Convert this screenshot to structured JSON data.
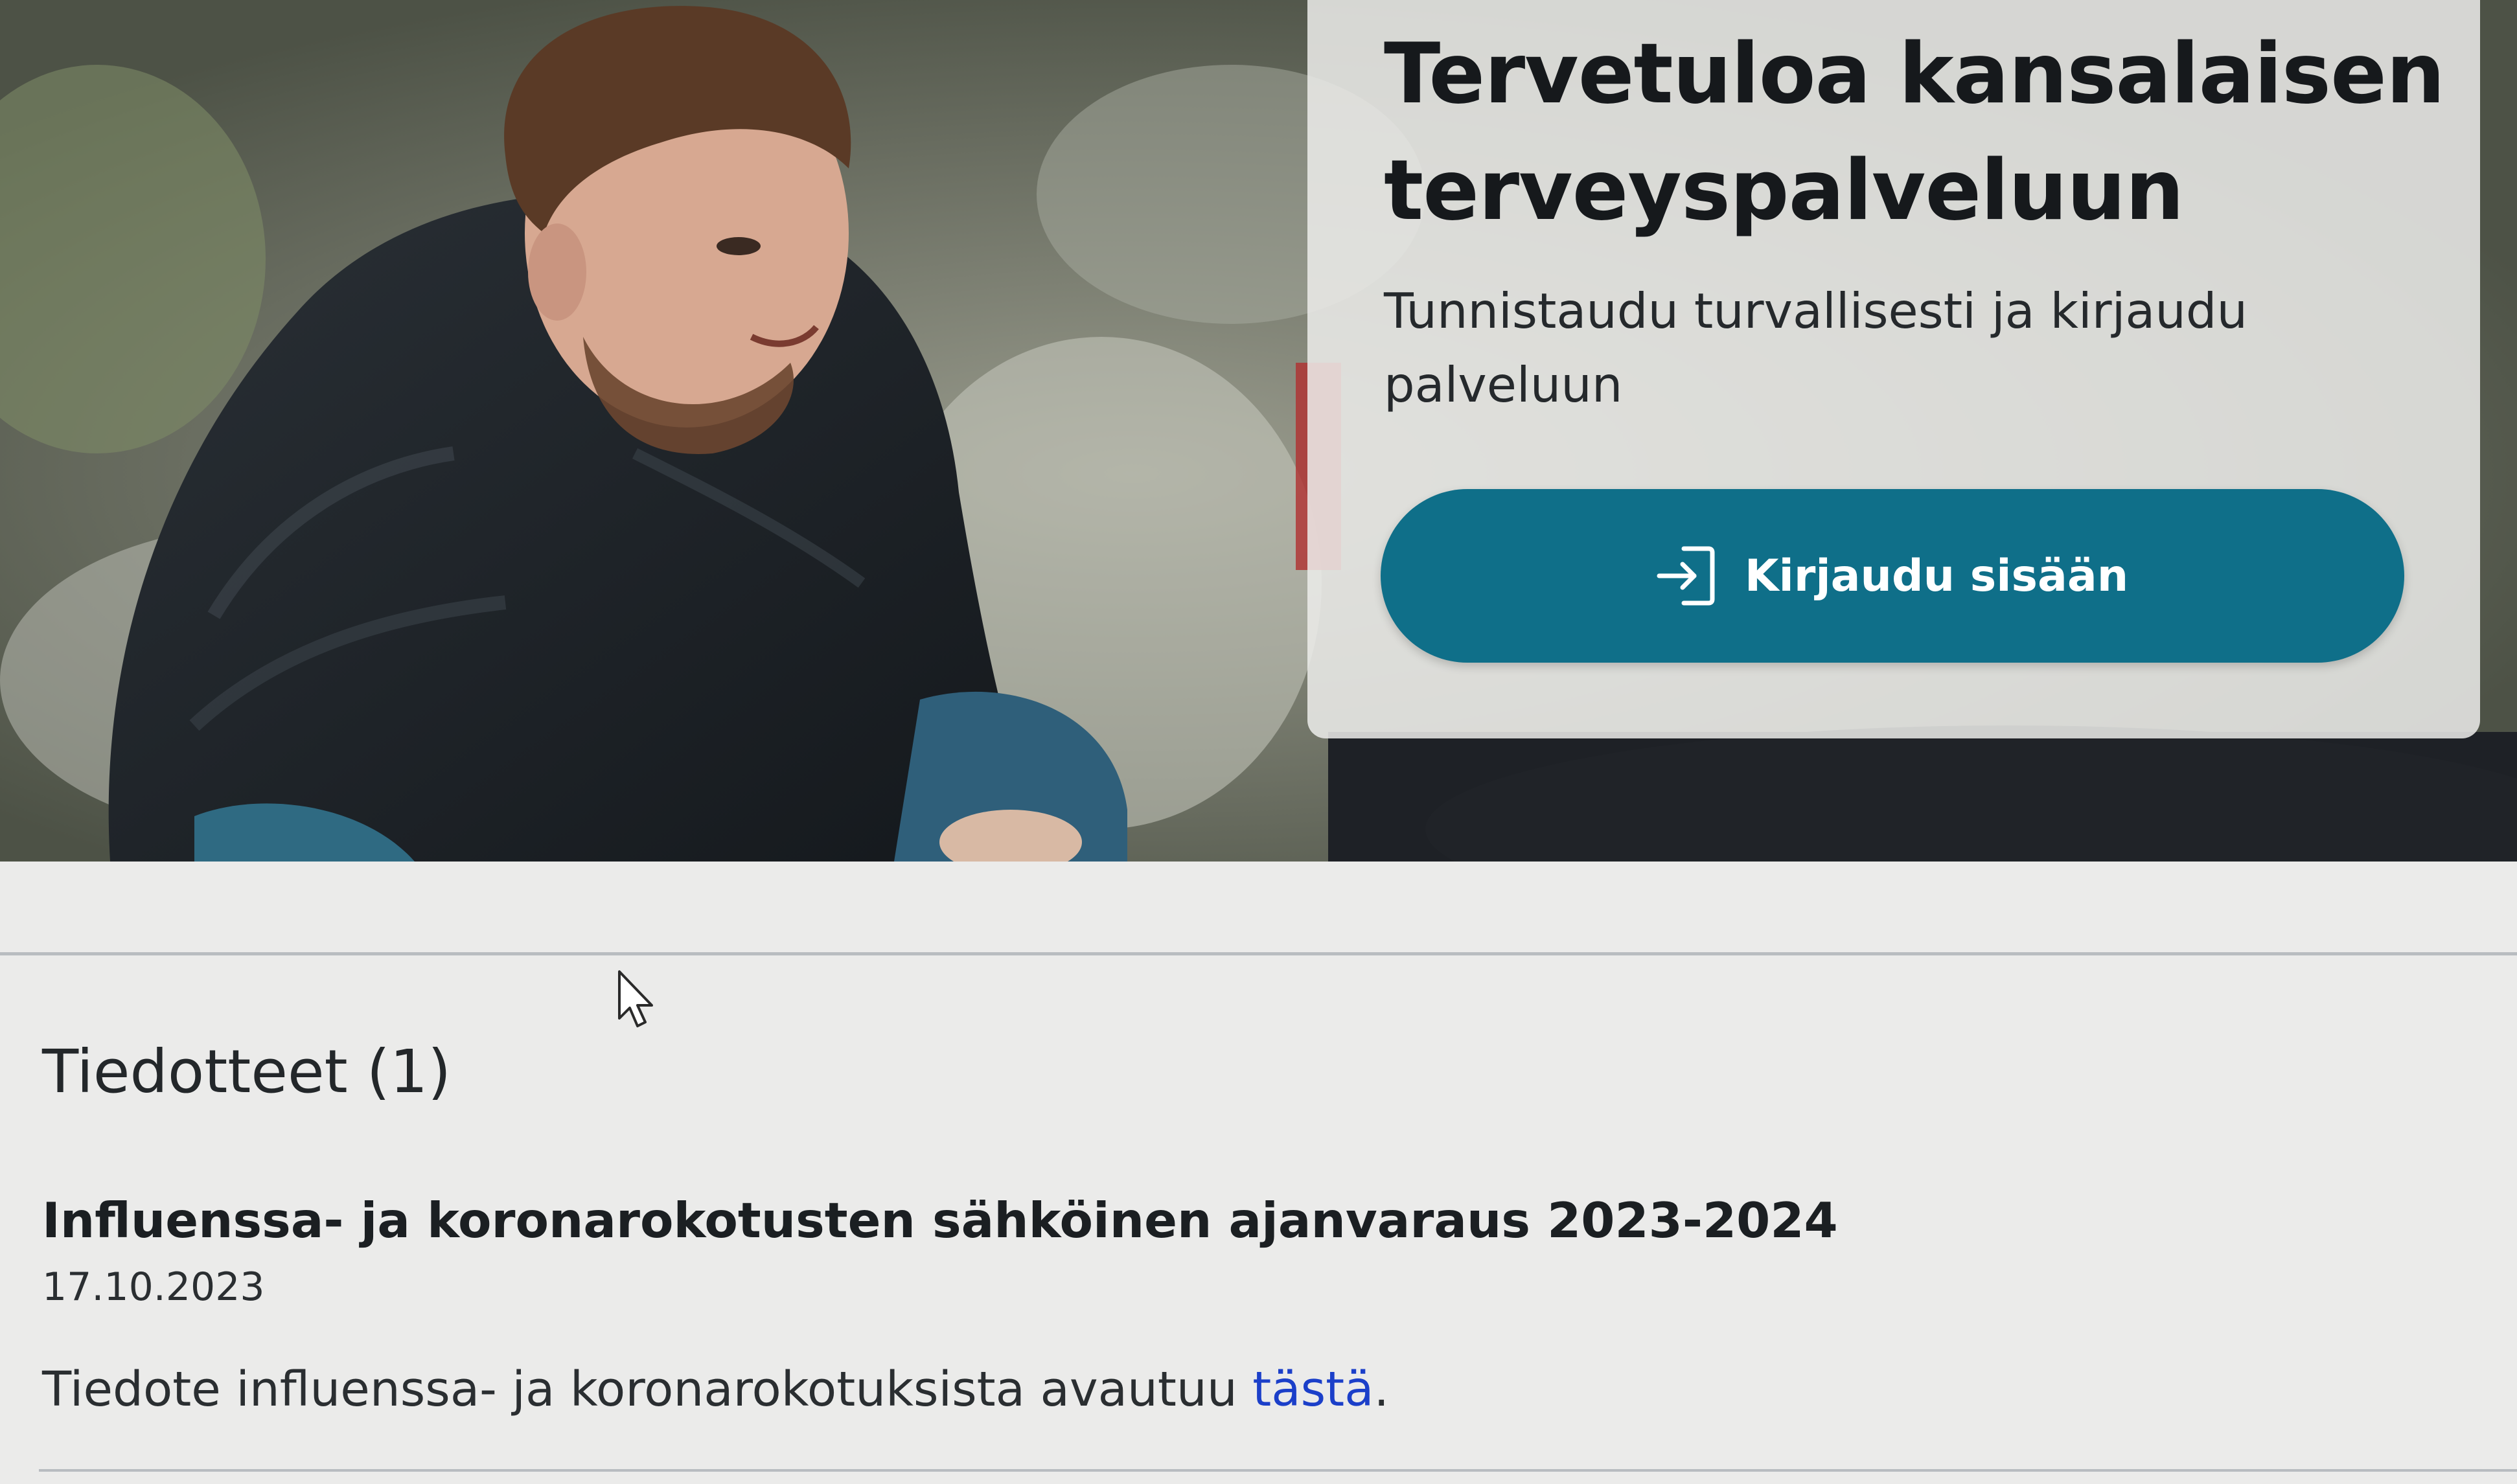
{
  "hero": {
    "title": "Tervetuloa kansalaisen terveyspalveluun",
    "subtitle": "Tunnistaudu turvallisesti ja kirjaudu palveluun",
    "login_button_label": "Kirjaudu sisään",
    "login_icon": "login-icon"
  },
  "notices": {
    "heading": "Tiedotteet (1)",
    "items": [
      {
        "title": "Influenssa- ja koronarokotusten sähköinen ajanvaraus 2023-2024",
        "date": "17.10.2023",
        "body_prefix": "Tiedote influenssa- ja koronarokotuksista avautuu ",
        "link_text": "tästä",
        "body_suffix": "."
      }
    ]
  },
  "colors": {
    "primary_button": "#0f6f89",
    "link": "#1b3fc9",
    "background": "#ebebea"
  }
}
